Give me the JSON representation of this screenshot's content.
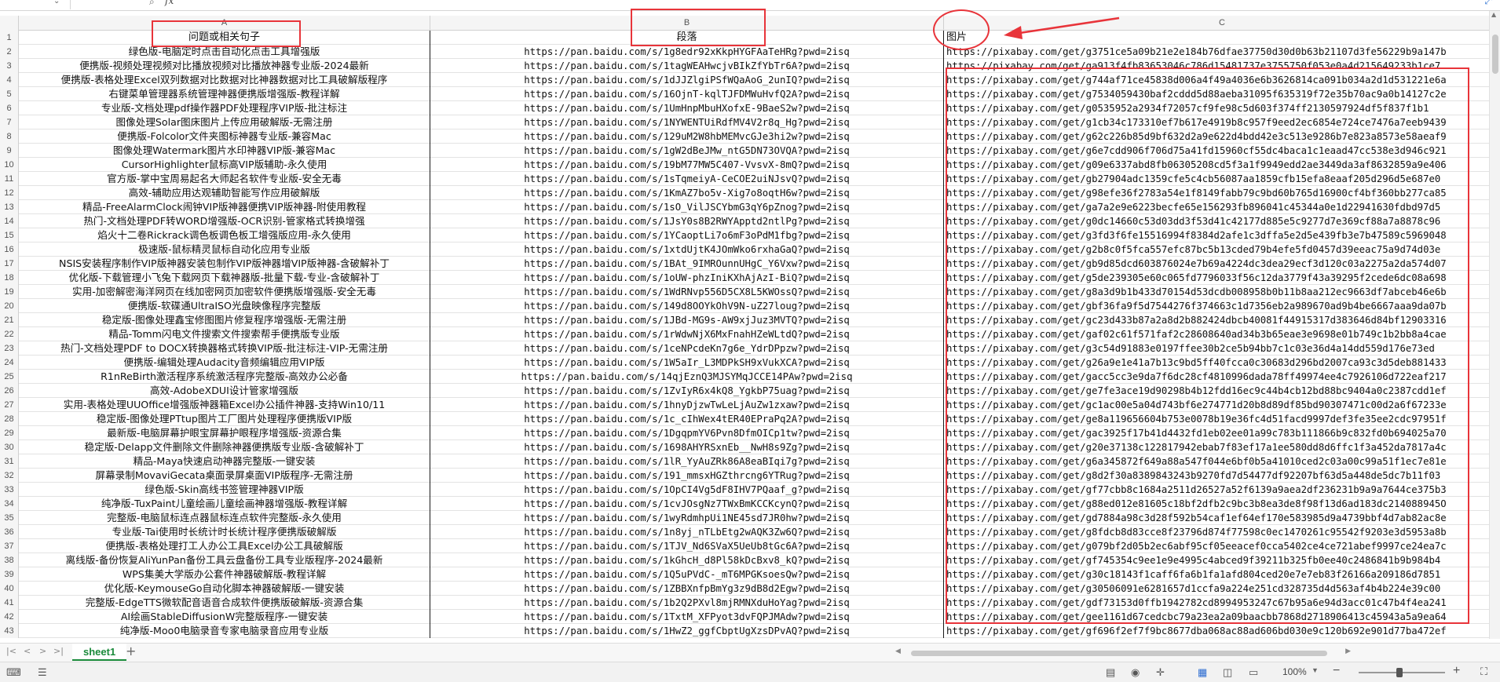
{
  "formula_bar": {
    "name_box": "",
    "fx": "fx"
  },
  "columns": [
    "A",
    "B",
    "C"
  ],
  "header_row": {
    "row": "1",
    "a": "问题或相关句子",
    "b": "段落",
    "c": "图片"
  },
  "rows": [
    {
      "n": "2",
      "a": "绿色版-电脑定时点击自动化点击工具增强版",
      "b": "https://pan.baidu.com/s/1g8edr92xKkpHYGFAaTeHRg?pwd=2isq",
      "c": "https://pixabay.com/get/g3751ce5a09b21e2e184b76dfae37750d30d0b63b21107d3fe56229b9a147b"
    },
    {
      "n": "3",
      "a": "便携版-视频处理视频对比播放视频对比播放神器专业版-2024最新",
      "b": "https://pan.baidu.com/s/1tagWEAHwcjvBIkZfYbTr6A?pwd=2isq",
      "c": "https://pixabay.com/get/ga913f4fb83653046c786d15481737e3755750f053e0a4d215649233b1ce7"
    },
    {
      "n": "4",
      "a": "便携版-表格处理Excel双列数据对比数据对比神器数据对比工具破解版程序",
      "b": "https://pan.baidu.com/s/1dJJZlgiPSfWQaAoG_2unIQ?pwd=2isq",
      "c": "https://pixabay.com/get/g744af71ce45838d006a4f49a4036e6b3626814ca091b034a2d1d531221e6a"
    },
    {
      "n": "5",
      "a": "右键菜单管理器系统管理神器便携版增强版-教程详解",
      "b": "https://pan.baidu.com/s/16OjnT-kqlTJFDMWuHvfQ2A?pwd=2isq",
      "c": "https://pixabay.com/get/g7534059430baf2cddd5d88aeba31095f635319f72e35b70ac9a0b14127c2e"
    },
    {
      "n": "6",
      "a": "专业版-文档处理pdf操作器PDF处理程序VIP版-批注标注",
      "b": "https://pan.baidu.com/s/1UmHnpMbuHXofxE-9BaeS2w?pwd=2isq",
      "c": "https://pixabay.com/get/g0535952a2934f72057cf9fe98c5d603f374ff2130597924df5f837f1b1"
    },
    {
      "n": "7",
      "a": "图像处理Solar图床图片上传应用破解版-无需注册",
      "b": "https://pan.baidu.com/s/1NYWENTUiRdfMV4V2r8q_Hg?pwd=2isq",
      "c": "https://pixabay.com/get/g1cb34c173310ef7b617e4919b8c957f9eed2ec6854e724ce7476a7eeb9439"
    },
    {
      "n": "8",
      "a": "便携版-Folcolor文件夹图标神器专业版-兼容Mac",
      "b": "https://pan.baidu.com/s/129uM2W8hbMEMvcGJe3hi2w?pwd=2isq",
      "c": "https://pixabay.com/get/g62c226b85d9bf632d2a9e622d4bdd42e3c513e9286b7e823a8573e58aeaf9"
    },
    {
      "n": "9",
      "a": "图像处理Watermark图片水印神器VIP版-兼容Mac",
      "b": "https://pan.baidu.com/s/1gW2dBeJMw_ntG5DN73OVQA?pwd=2isq",
      "c": "https://pixabay.com/get/g6e7cdd906f706d75a41fd15960cf55dc4baca1c1eaad47cc538e3d946c921"
    },
    {
      "n": "10",
      "a": "CursorHighlighter鼠标高VIP版辅助-永久使用",
      "b": "https://pan.baidu.com/s/19bM77MW5C407-VvsvX-8mQ?pwd=2isq",
      "c": "https://pixabay.com/get/g09e6337abd8fb06305208cd5f3a1f9949edd2ae3449da3af8632859a9e406"
    },
    {
      "n": "11",
      "a": "官方版-掌中宝周易起名大师起名软件专业版-安全无毒",
      "b": "https://pan.baidu.com/s/1sTqmeiyA-CeCOE2uiNJsvQ?pwd=2isq",
      "c": "https://pixabay.com/get/gb27904adc1359cfe5c4cb56087aa1859cfb15efa8eaaf205d296d5e687e0"
    },
    {
      "n": "12",
      "a": "高效-辅助应用达观辅助智能写作应用破解版",
      "b": "https://pan.baidu.com/s/1KmAZ7bo5v-Xig7o8oqtH6w?pwd=2isq",
      "c": "https://pixabay.com/get/g98efe36f2783a54e1f8149fabb79c9bd60b765d16900cf4bf360bb277ca85"
    },
    {
      "n": "13",
      "a": "精品-FreeAlarmClock闹钟VIP版神器便携VIP版神器-附使用教程",
      "b": "https://pan.baidu.com/s/1sO_VilJSCYbmG3qY6pZnog?pwd=2isq",
      "c": "https://pixabay.com/get/ga7a2e9e6223becfe65e156293fb896041c45344a0e1d22941630fdbd97d5"
    },
    {
      "n": "14",
      "a": "热门-文档处理PDF转WORD增强版-OCR识别-管家格式转换增强",
      "b": "https://pan.baidu.com/s/1JsY0s8B2RWYApptd2ntlPg?pwd=2isq",
      "c": "https://pixabay.com/get/g0dc14660c53d03dd3f53d41c42177d885e5c9277d7e369cf88a7a8878c96"
    },
    {
      "n": "15",
      "a": "焰火十二卷Rickrack调色板调色板工增强版应用-永久使用",
      "b": "https://pan.baidu.com/s/1YCaoptLi7o6mF3oPdM1fbg?pwd=2isq",
      "c": "https://pixabay.com/get/g3fd3f6fe15516994f8384d2afe1c3dffa5e2d5e439fb3e7b47589c5969048"
    },
    {
      "n": "16",
      "a": "极速版-鼠标精灵鼠标自动化应用专业版",
      "b": "https://pan.baidu.com/s/1xtdUjtK4JOmWko6rxhaGaQ?pwd=2isq",
      "c": "https://pixabay.com/get/g2b8c0f5fca557efc87bc5b13cded79b4efe5fd0457d39eeac75a9d74d03e"
    },
    {
      "n": "17",
      "a": "NSIS安装程序制作VIP版神器安装包制作VIP版神器增VIP版神器-含破解补丁",
      "b": "https://pan.baidu.com/s/1BAt_9IMROunnUHgC_Y6Vxw?pwd=2isq",
      "c": "https://pixabay.com/get/gb9d85dcd603876024e7b69a4224dc3dea29ecf3d120c03a2275a2da574d07"
    },
    {
      "n": "18",
      "a": "优化版-下载管理小飞兔下载网页下载神器版-批量下载-专业-含破解补丁",
      "b": "https://pan.baidu.com/s/1oUW-phzIniKXhAjAzI-BiQ?pwd=2isq",
      "c": "https://pixabay.com/get/g5de239305e60c065fd7796033f56c12da3779f43a39295f2cede6dc08a698"
    },
    {
      "n": "19",
      "a": "实用-加密解密海洋网页在线加密网页加密软件便携版增强版-安全无毒",
      "b": "https://pan.baidu.com/s/1WdRNvp556D5CX8L5KWOssQ?pwd=2isq",
      "c": "https://pixabay.com/get/g8a3d9b1b433d70154d53dcdb008958b0b11b8aa212ec9663df7abceb46e6b"
    },
    {
      "n": "20",
      "a": "便携版-软碟通UltraISO光盘映像程序完整版",
      "b": "https://pan.baidu.com/s/149d8OOYkOhV9N-uZ27loug?pwd=2isq",
      "c": "https://pixabay.com/get/gbf36fa9f5d7544276f374663c1d7356eb2a989670ad9b4be6667aaa9da07b"
    },
    {
      "n": "21",
      "a": "稳定版-图像处理鑫宝修图图片修复程序增强版-无需注册",
      "b": "https://pan.baidu.com/s/1JBd-MG9s-AW9xjJuz3MVTQ?pwd=2isq",
      "c": "https://pixabay.com/get/gc23d433b87a2a8d2b882424dbcb40081f44915317d383646d84bf12903316"
    },
    {
      "n": "22",
      "a": "精品-Tomm闪电文件搜索文件搜索帮手便携版专业版",
      "b": "https://pan.baidu.com/s/1rWdwNjX6MxFnahHZeWLtdQ?pwd=2isq",
      "c": "https://pixabay.com/get/gaf02c61f571faf2c28608640ad34b3b65eae3e9698e01b749c1b2bb8a4cae"
    },
    {
      "n": "23",
      "a": "热门-文档处理PDF to DOCX转换器格式转换VIP版-批注标注-VIP-无需注册",
      "b": "https://pan.baidu.com/s/1ceNPcdeKn7g6e_YdrDPpzw?pwd=2isq",
      "c": "https://pixabay.com/get/g3c54d91883e0197ffee30b2ce5b94bb7c1c03e36d4a14dd559d176e73ed"
    },
    {
      "n": "24",
      "a": "便携版-编辑处理Audacity音频编辑应用VIP版",
      "b": "https://pan.baidu.com/s/1W5aIr_L3MDPkSH9xVukXCA?pwd=2isq",
      "c": "https://pixabay.com/get/g26a9e1e41a7b13c9bd5ff40fcca0c30683d296bd2007ca93c3d5deb881433"
    },
    {
      "n": "25",
      "a": "R1nReBirth激活程序系统激活程序完整版-高效办公必备",
      "b": "https://pan.baidu.com/s/14qjEznQ3MJSYMqJCCE14PAw?pwd=2isq",
      "c": "https://pixabay.com/get/gacc5cc3e9da7f6dc28cf4810996dada78ff49974ee4c7926106d722eaf217"
    },
    {
      "n": "26",
      "a": "高效-AdobeXDUI设计管家增强版",
      "b": "https://pan.baidu.com/s/1ZvIyR6x4kQ8_YgkbP75uag?pwd=2isq",
      "c": "https://pixabay.com/get/ge7fe3ace19d90298b4b12fdd16ec9c44b4cb12bd88bc9404a0c2387cdd1ef"
    },
    {
      "n": "27",
      "a": "实用-表格处理UUOffice增强版神器箱Excel办公插件神器-支持Win10/11",
      "b": "https://pan.baidu.com/s/1hnyDjzwTwLeLjAuZw1zxaw?pwd=2isq",
      "c": "https://pixabay.com/get/gc1ac00e5a04d743bf6e274771d20b8d89df85bd90307471c00d2a6f67233e"
    },
    {
      "n": "28",
      "a": "稳定版-图像处理PTtup图片工厂图片处理程序便携版VIP版",
      "b": "https://pan.baidu.com/s/1c_cIhWex4tER40EPraPq2A?pwd=2isq",
      "c": "https://pixabay.com/get/ge8a119656604b753e0078b19e36fc4d51facd9997def3fe35ee2cdc97951f"
    },
    {
      "n": "29",
      "a": "最新版-电脑屏幕护眼宝屏幕护眼程序增强版-资源合集",
      "b": "https://pan.baidu.com/s/1DgqpmYV6Pvn8DfmOICp1tw?pwd=2isq",
      "c": "https://pixabay.com/get/gac3925f17b41d4432fd1eb02ee01a99c783b111866b9c832fd0b694025a70"
    },
    {
      "n": "30",
      "a": "稳定版-Delapp文件删除文件删除神器便携版专业版-含破解补丁",
      "b": "https://pan.baidu.com/s/1698AHYRSxnEb__NwH8s9Zg?pwd=2isq",
      "c": "https://pixabay.com/get/g20e37138c122817942ebab7f83ef17a1ee580dd8d6ffc1f3a452da7817a4c"
    },
    {
      "n": "31",
      "a": "精品-Maya快速启动神器完整版-一键安装",
      "b": "https://pan.baidu.com/s/1lR_YyAuZRk86A8eaBIqi7g?pwd=2isq",
      "c": "https://pixabay.com/get/g6a345872f649a88a547f044e6bf0b5a41010ced2c03a00c99a51f1ec7e81e"
    },
    {
      "n": "32",
      "a": "屏幕录制MovaviGecata桌面录屏桌面VIP版程序-无需注册",
      "b": "https://pan.baidu.com/s/191_mmsxHGZthrcng6YTRug?pwd=2isq",
      "c": "https://pixabay.com/get/g8d2f30a8389843243b9270fd7d54477df92207bf63d5a448de5dc7b11f03"
    },
    {
      "n": "33",
      "a": "绿色版-Skin高线书签管理神器VIP版",
      "b": "https://pan.baidu.com/s/1OpCI4Vg5dF8IHV7PQaaf_g?pwd=2isq",
      "c": "https://pixabay.com/get/gf77cbb8c1684a2511d26527a52f6139a9aea2df236231b9a9a7644ce375b3"
    },
    {
      "n": "34",
      "a": "纯净版-TuxPaint儿童绘画儿童绘画神器增强版-教程详解",
      "b": "https://pan.baidu.com/s/1cvJOsgNz7TWxBmKCCKcynQ?pwd=2isq",
      "c": "https://pixabay.com/get/g88ed012e81605c18bf2dfb2c9bc3b8ea3de8f98f13d6ad183dc214088945O"
    },
    {
      "n": "35",
      "a": "完整版-电脑鼠标连点器鼠标连点软件完整版-永久使用",
      "b": "https://pan.baidu.com/s/1wyRdmhpUi1NE45sd7JR0hw?pwd=2isq",
      "c": "https://pixabay.com/get/gd7884a98c3d28f592b54caf1ef64ef170e583985d9a4739bbf4d7ab82ac8e"
    },
    {
      "n": "36",
      "a": "专业版-Tai使用时长统计时长统计程序便携版破解版",
      "b": "https://pan.baidu.com/s/1n8yj_nTLbEtg2wAQK3Zw6Q?pwd=2isq",
      "c": "https://pixabay.com/get/g8fdcb8d83cce8f23796d874f77598c0ec1470261c95542f9203e3d5953a8b"
    },
    {
      "n": "37",
      "a": "便携版-表格处理打工人办公工具Excel办公工具破解版",
      "b": "https://pan.baidu.com/s/1TJV_Nd6SVaX5UeUb8tGc6A?pwd=2isq",
      "c": "https://pixabay.com/get/g079bf2d05b2ec6abf95cf05eeacef0cca5402ce4ce721abef9997ce24ea7c"
    },
    {
      "n": "38",
      "a": "离线版-备份恢复AliYunPan备份工具云盘备份工具专业版程序-2024最新",
      "b": "https://pan.baidu.com/s/1kGhcH_d8Pl58kDcBxv8_kQ?pwd=2isq",
      "c": "https://pixabay.com/get/gf745354c9ee1e9e4995c4abced9f39211b325fb0ee40c2486841b9b984b4"
    },
    {
      "n": "39",
      "a": "WPS集美大学版办公套件神器破解版-教程详解",
      "b": "https://pan.baidu.com/s/1Q5uPVdC-_mT6MPGKsoesQw?pwd=2isq",
      "c": "https://pixabay.com/get/g30c18143f1caff6fa6b1fa1afd804ced20e7e7eb83f26166a209186d7851"
    },
    {
      "n": "40",
      "a": "优化版-KeymouseGo自动化脚本神器破解版-一键安装",
      "b": "https://pan.baidu.com/s/1ZBBXnfpBmYg3z9dB8d2Egw?pwd=2isq",
      "c": "https://pixabay.com/get/g30506091e6281657d1ccfa9a224e251cd328735d4d563af4b4b224e39c00"
    },
    {
      "n": "41",
      "a": "完整版-EdgeTTS微软配音语音合成软件便携版破解版-资源合集",
      "b": "https://pan.baidu.com/s/1b2Q2PXvl8mjRMNXduHoYag?pwd=2isq",
      "c": "https://pixabay.com/get/gdf73153d0ffb1942782cd8994953247c67b95a6e94d3acc01c47b4f4ea241"
    },
    {
      "n": "42",
      "a": "AI绘画StableDiffusionW完整版程序-一键安装",
      "b": "https://pan.baidu.com/s/1TxtM_XFPyot3dvFQPJMAdw?pwd=2isq",
      "c": "https://pixabay.com/get/gee1161d67cedcbc79a23ea2a09baacbb7868d2718906413c45943a5a9ea64"
    },
    {
      "n": "43",
      "a": "纯净版-Moo0电脑录音专家电脑录音应用专业版",
      "b": "https://pan.baidu.com/s/1HwZ2_ggfCbptUgXzsDPvAQ?pwd=2isq",
      "c": "https://pixabay.com/get/gf696f2ef7f9bc8677dba068ac88ad606bd030e9c120b692e901d77ba472ef"
    }
  ],
  "sheet_bar": {
    "tab": "sheet1",
    "add": "+",
    "nav_first": "|<",
    "nav_prev": "<",
    "nav_next": ">",
    "nav_last": ">|"
  },
  "status_bar": {
    "zoom": "100%"
  },
  "colors": {
    "annotation": "#e8343a",
    "sheet_tab": "#1a8a3a"
  }
}
